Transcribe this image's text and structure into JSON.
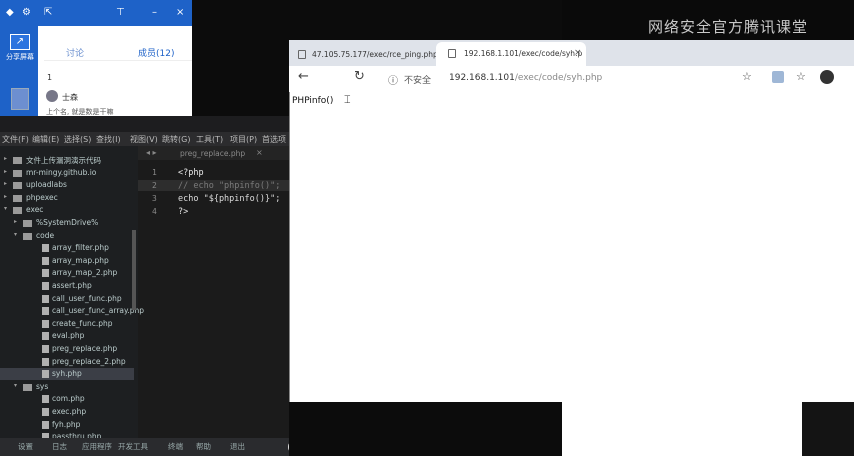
{
  "chat": {
    "share_label": "分享屏幕",
    "tab_discussion": "讨论",
    "tab_members": "成员(12)",
    "message_number": "1",
    "message_author": "士森",
    "message_text": "上个名, 就是数是干嘛"
  },
  "watermark": "网络安全官方腾讯课堂",
  "editor": {
    "menu": [
      "文件(F)",
      "编辑(E)",
      "选择(S)",
      "查找(I)",
      "视图(V)",
      "跳转(G)",
      "工具(T)",
      "项目(P)",
      "首选项"
    ],
    "tab_label": "preg_replace.php",
    "tree": [
      {
        "label": "文件上传漏洞演示代码",
        "type": "folder",
        "depth": 1
      },
      {
        "label": "mr-mingy.github.io",
        "type": "folder",
        "depth": 1
      },
      {
        "label": "uploadlabs",
        "type": "folder",
        "depth": 1
      },
      {
        "label": "phpexec",
        "type": "folder",
        "depth": 1
      },
      {
        "label": "exec",
        "type": "folder-open",
        "depth": 1
      },
      {
        "label": "%SystemDrive%",
        "type": "folder",
        "depth": 2
      },
      {
        "label": "code",
        "type": "folder-open",
        "depth": 2
      },
      {
        "label": "array_filter.php",
        "type": "file",
        "depth": 3
      },
      {
        "label": "array_map.php",
        "type": "file",
        "depth": 3
      },
      {
        "label": "array_map_2.php",
        "type": "file",
        "depth": 3
      },
      {
        "label": "assert.php",
        "type": "file",
        "depth": 3
      },
      {
        "label": "call_user_func.php",
        "type": "file",
        "depth": 3
      },
      {
        "label": "call_user_func_array.php",
        "type": "file",
        "depth": 3
      },
      {
        "label": "create_func.php",
        "type": "file",
        "depth": 3
      },
      {
        "label": "eval.php",
        "type": "file",
        "depth": 3
      },
      {
        "label": "preg_replace.php",
        "type": "file",
        "depth": 3
      },
      {
        "label": "preg_replace_2.php",
        "type": "file",
        "depth": 3
      },
      {
        "label": "syh.php",
        "type": "file",
        "depth": 3,
        "selected": true
      },
      {
        "label": "sys",
        "type": "folder-open",
        "depth": 2
      },
      {
        "label": "com.php",
        "type": "file",
        "depth": 3
      },
      {
        "label": "exec.php",
        "type": "file",
        "depth": 3
      },
      {
        "label": "fyh.php",
        "type": "file",
        "depth": 3
      },
      {
        "label": "passthru.php",
        "type": "file",
        "depth": 3
      }
    ],
    "line_numbers": [
      "1",
      "2",
      "3",
      "4"
    ],
    "code_lines": [
      "<?php",
      "// echo \"phpinfo()\";",
      "echo \"${phpinfo()}\";",
      "?>"
    ]
  },
  "statusbar": [
    "设置",
    "日志",
    "应用程序",
    "开发工具",
    "终端",
    "帮助",
    "退出"
  ],
  "browser": {
    "tab1_title": "47.105.75.177/exec/rce_ping.php",
    "tab2_title": "192.168.1.101/exec/code/syh.p",
    "not_secure": "不安全",
    "url_host": "192.168.1.101",
    "url_path": "/exec/code/syh.php",
    "page_text": "PHPinfo()"
  }
}
